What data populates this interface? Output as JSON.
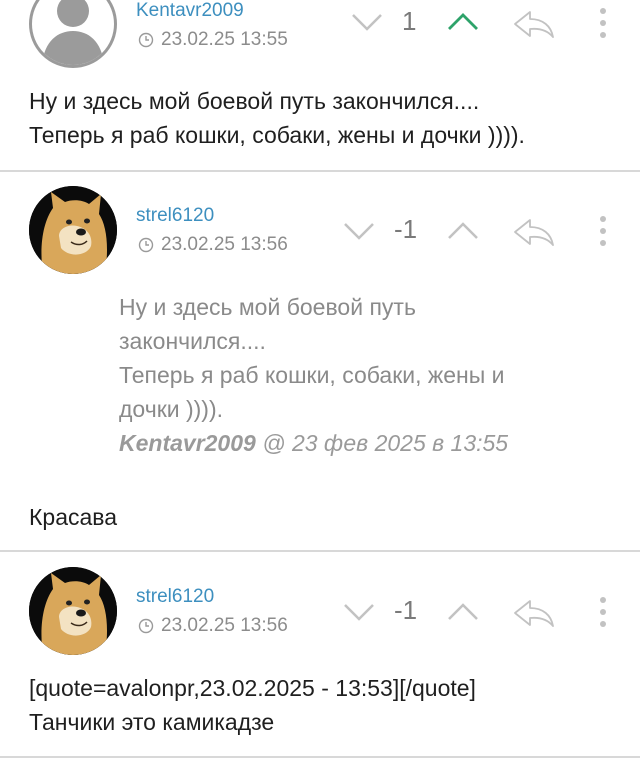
{
  "posts": [
    {
      "username": "Kentavr2009",
      "date": "23.02.25 13:55",
      "score": "1",
      "body": [
        "Ну и здесь мой боевой путь закончился....",
        "Теперь я раб кошки, собаки, жены и дочки ))))."
      ]
    },
    {
      "username": "strel6120",
      "date": "23.02.25 13:56",
      "score": "-1",
      "quote": {
        "lines": [
          "Ну и здесь мой боевой путь",
          "закончился....",
          "Теперь я раб кошки, собаки, жены и",
          "дочки ))))."
        ],
        "author": "Kentavr2009",
        "when": " @ 23 фев 2025 в 13:55"
      },
      "body": [
        "Красава"
      ]
    },
    {
      "username": "strel6120",
      "date": "23.02.25 13:56",
      "score": "-1",
      "body": [
        "[quote=avalonpr,23.02.2025 - 13:53][/quote]",
        "Танчики это камикадзе"
      ]
    }
  ],
  "icons": {
    "downvote": "chevron-down-icon",
    "upvote": "chevron-up-icon",
    "reply": "reply-arrow-icon",
    "more": "more-vertical-icon",
    "clock": "clock-icon"
  },
  "colors": {
    "username": "#3d8fbf",
    "upvote_active": "#2ea36a",
    "icon_gray": "#bdbdbd"
  }
}
